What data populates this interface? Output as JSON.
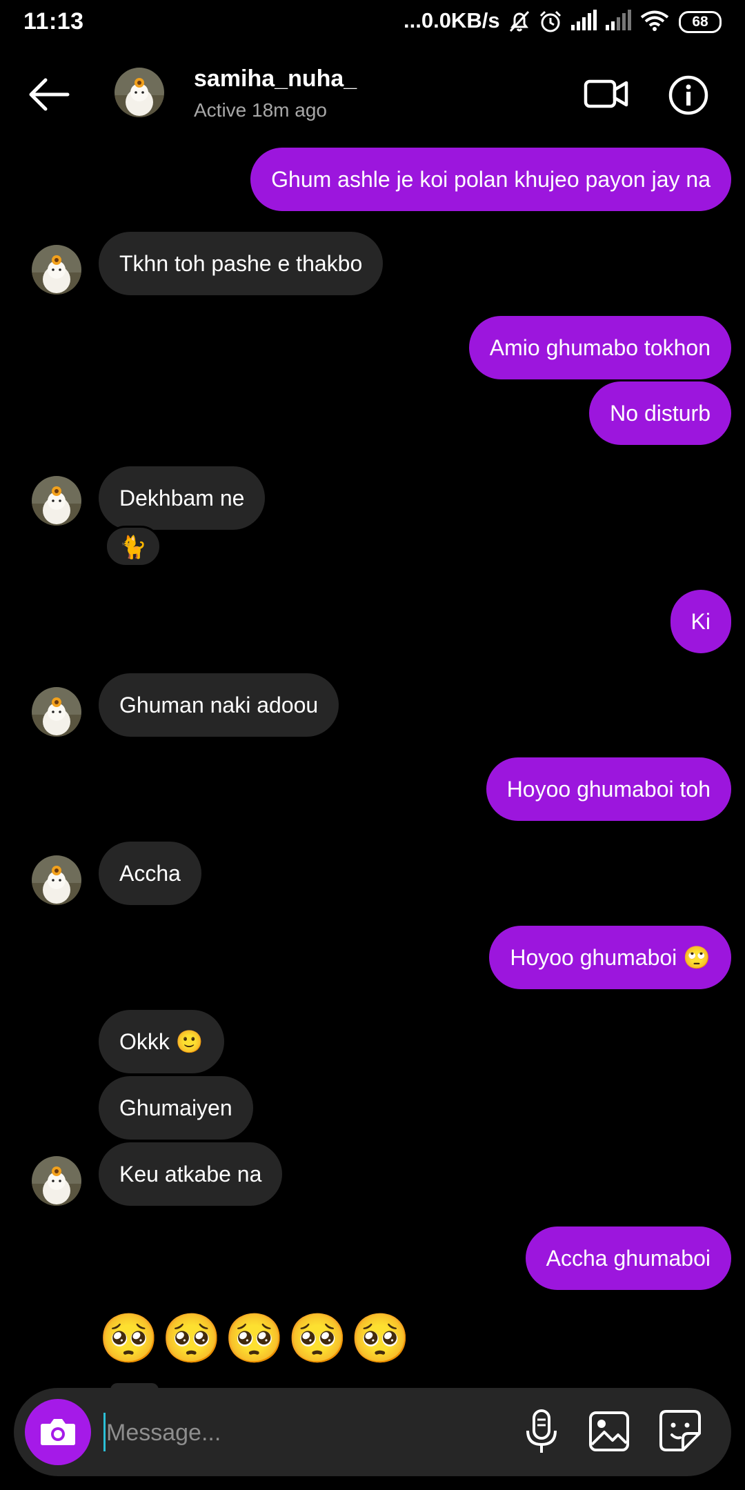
{
  "status_bar": {
    "time": "11:13",
    "network_speed": "...0.0KB/s",
    "battery": "68"
  },
  "header": {
    "username": "samiha_nuha_",
    "active_status": "Active 18m ago"
  },
  "messages": [
    {
      "dir": "out",
      "text": "Ghum ashle je koi polan khujeo payon jay na"
    },
    {
      "dir": "in",
      "text": "Tkhn toh pashe e thakbo"
    },
    {
      "dir": "out",
      "text": "Amio ghumabo tokhon"
    },
    {
      "dir": "out",
      "text": "No disturb"
    },
    {
      "dir": "in",
      "text": "Dekhbam ne",
      "reaction": "🐈"
    },
    {
      "dir": "out",
      "text": "Ki"
    },
    {
      "dir": "in",
      "text": "Ghuman naki adoou"
    },
    {
      "dir": "out",
      "text": "Hoyoo ghumaboi toh"
    },
    {
      "dir": "in",
      "text": "Accha"
    },
    {
      "dir": "out",
      "text": "Hoyoo ghumaboi 🙄"
    },
    {
      "dir": "in",
      "text": "Okkk 🙂"
    },
    {
      "dir": "in",
      "text": "Ghumaiyen"
    },
    {
      "dir": "in",
      "text": "Keu atkabe na"
    },
    {
      "dir": "out",
      "text": "Accha ghumaboi"
    },
    {
      "dir": "in",
      "text": "🥺🥺🥺🥺🥺"
    }
  ],
  "composer": {
    "placeholder": "Message..."
  },
  "icons": {
    "back": "arrow-left-icon",
    "video": "video-camera-icon",
    "info": "info-icon",
    "camera": "camera-icon",
    "mic": "microphone-icon",
    "gallery": "image-icon",
    "sticker": "sticker-icon"
  },
  "colors": {
    "outgoing_bubble": "#9c16dd",
    "incoming_bubble": "#262626",
    "camera_button": "#a51ae8",
    "background": "#000000"
  }
}
